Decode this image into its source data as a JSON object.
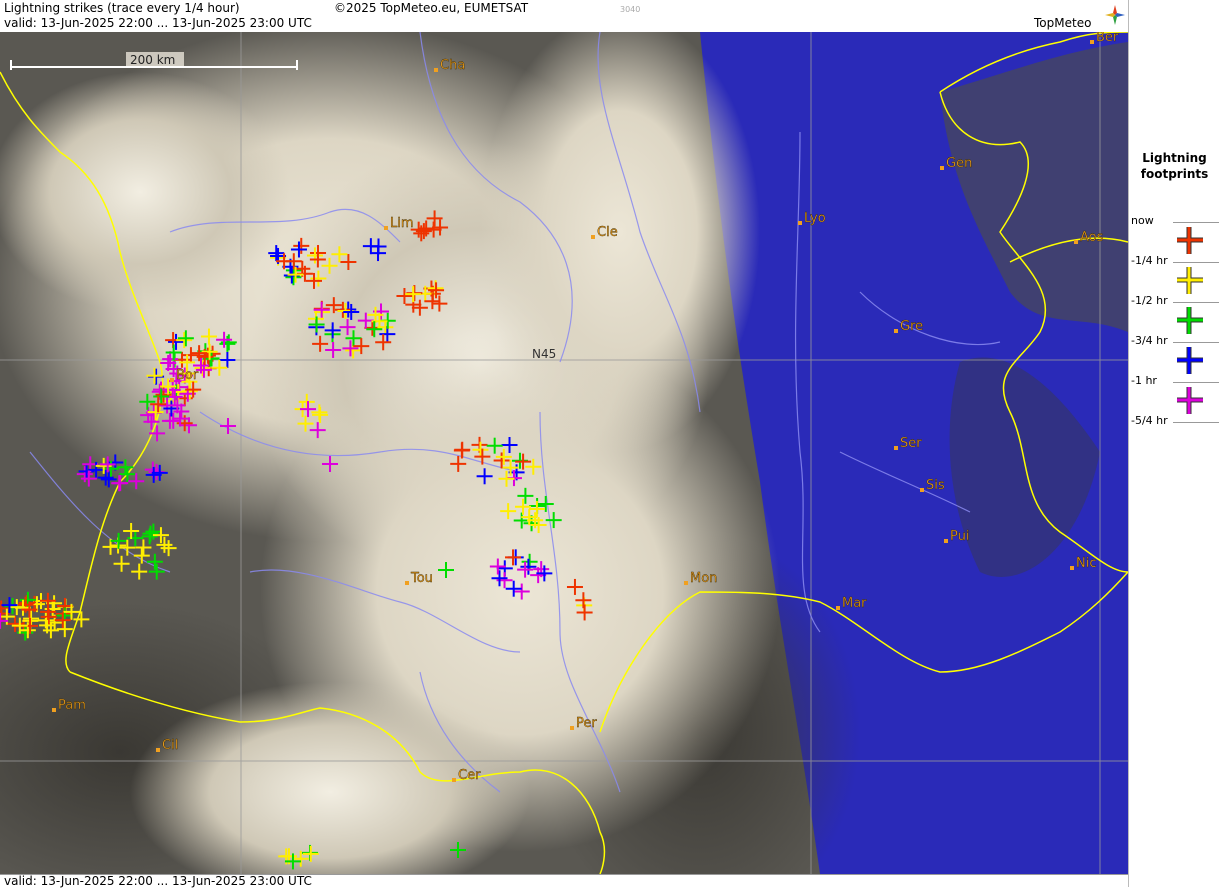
{
  "header": {
    "title": "Lightning strikes (trace every 1/4 hour)",
    "copyright": "©2025 TopMeteo.eu, EUMETSAT",
    "valid": "valid:  13-Jun-2025 22:00 ... 13-Jun-2025 23:00 UTC",
    "code": "3040"
  },
  "logo": {
    "text": "TopMeteo"
  },
  "footer": {
    "valid": "valid:  13-Jun-2025 22:00 ... 13-Jun-2025 23:00 UTC"
  },
  "scale": {
    "label": "200 km"
  },
  "grid": {
    "label": "N45"
  },
  "cities": [
    {
      "name": "Cha"
    },
    {
      "name": "Ber"
    },
    {
      "name": "Gen"
    },
    {
      "name": "Lim"
    },
    {
      "name": "Cle"
    },
    {
      "name": "Lyo"
    },
    {
      "name": "Aos"
    },
    {
      "name": "Gre"
    },
    {
      "name": "Bor"
    },
    {
      "name": "Ser"
    },
    {
      "name": "Sis"
    },
    {
      "name": "Pui"
    },
    {
      "name": "Tou"
    },
    {
      "name": "Mon"
    },
    {
      "name": "Nic"
    },
    {
      "name": "Mar"
    },
    {
      "name": "Pam"
    },
    {
      "name": "Per"
    },
    {
      "name": "Cil"
    },
    {
      "name": "Cer"
    }
  ],
  "legend": {
    "title_line1": "Lightning",
    "title_line2": "footprints",
    "items": [
      {
        "label": "now",
        "color": "#ee3300"
      },
      {
        "label": "-1/4 hr",
        "color": "#ffee00"
      },
      {
        "label": "-1/2 hr",
        "color": "#00dd00"
      },
      {
        "label": "-3/4 hr",
        "color": "#0000ff"
      },
      {
        "label": "-1 hr",
        "color": "#dd00dd"
      },
      {
        "label": "-5/4 hr",
        "color": ""
      }
    ]
  },
  "colors": {
    "now": "#ee3300",
    "q1": "#ffee00",
    "q2": "#00dd00",
    "q3": "#0000ff",
    "q4": "#dd00dd",
    "city": "#f0a020",
    "border": "#ffff00",
    "river": "#8a8af0",
    "sea": "#2a2ab8"
  }
}
